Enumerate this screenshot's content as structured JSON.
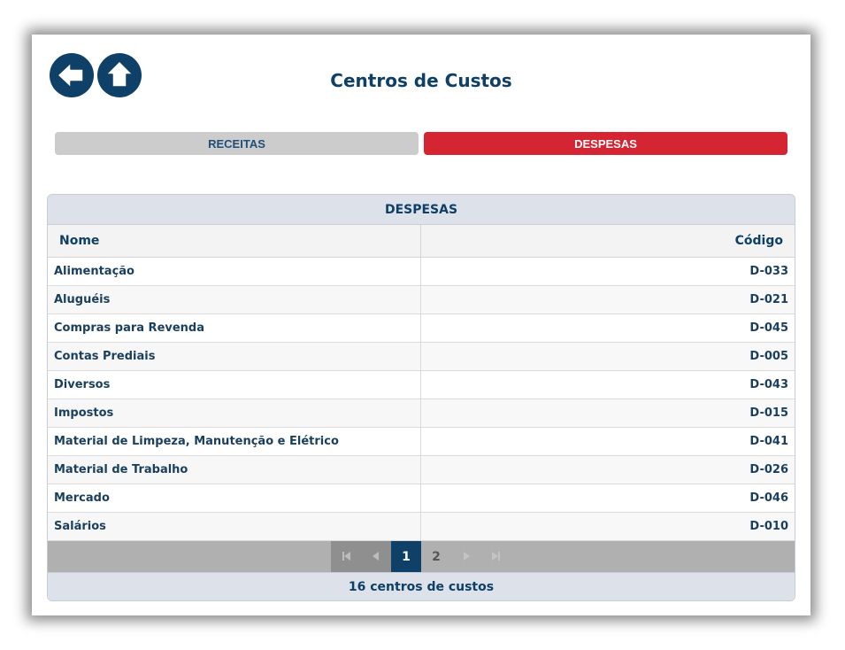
{
  "header": {
    "title": "Centros de Custos",
    "back_icon": "arrow-left-icon",
    "home_icon": "arrow-up-icon"
  },
  "tabs": [
    {
      "label": "RECEITAS",
      "active": false
    },
    {
      "label": "DESPESAS",
      "active": true
    }
  ],
  "panel": {
    "title": "DESPESAS",
    "columns": {
      "nome": "Nome",
      "codigo": "Código"
    },
    "rows": [
      {
        "nome": "Alimentação",
        "codigo": "D-033"
      },
      {
        "nome": "Aluguéis",
        "codigo": "D-021"
      },
      {
        "nome": "Compras para Revenda",
        "codigo": "D-045"
      },
      {
        "nome": "Contas Prediais",
        "codigo": "D-005"
      },
      {
        "nome": "Diversos",
        "codigo": "D-043"
      },
      {
        "nome": "Impostos",
        "codigo": "D-015"
      },
      {
        "nome": "Material de Limpeza, Manutenção e Elétrico",
        "codigo": "D-041"
      },
      {
        "nome": "Material de Trabalho",
        "codigo": "D-026"
      },
      {
        "nome": "Mercado",
        "codigo": "D-046"
      },
      {
        "nome": "Salários",
        "codigo": "D-010"
      }
    ],
    "pagination": {
      "current": "1",
      "next": "2"
    },
    "footer": "16 centros de custos"
  },
  "colors": {
    "accent": "#0e4068",
    "active_tab": "#d62532",
    "inactive_tab": "#cccccc"
  }
}
